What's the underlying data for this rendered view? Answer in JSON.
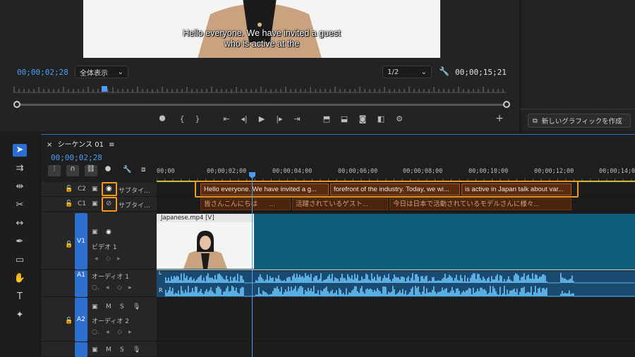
{
  "program_monitor": {
    "caption_line1": "Hello everyone. We have invited a guest",
    "caption_line2": "who is active at the",
    "current_timecode": "00;00;02;28",
    "zoom_label": "全体表示",
    "resolution_label": "1/2",
    "duration_timecode": "00;00;15;21"
  },
  "right_panel": {
    "new_graphic_label": "新しいグラフィックを作成"
  },
  "timeline": {
    "tab_label": "シーケンス 01",
    "timecode": "00;00;02;28",
    "ruler": [
      "00;00",
      "00;00;02;00",
      "00;00;04;00",
      "00;00;06;00",
      "00;00;08;00",
      "00;00;10;00",
      "00;00;12;00",
      "00;00;14;00"
    ],
    "tracks": {
      "c2": {
        "badge": "C2",
        "name": "サブタイ..."
      },
      "c1": {
        "badge": "C1",
        "name": "サブタイ..."
      },
      "v1": {
        "badge": "V1",
        "name": "ビデオ 1"
      },
      "a1": {
        "badge": "A1",
        "name": "オーディオ 1"
      },
      "a2": {
        "badge": "A2",
        "name": "オーディオ 2"
      }
    },
    "c2_clips": [
      "Hello everyone. We have invited a g...",
      "forefront of the industry. Today, we wi...",
      "is active in Japan talk about var..."
    ],
    "c1_clips": [
      "皆さんこんにちは",
      "...",
      "活躍されているゲスト...",
      "今日は日本で活動されているモデルさんに様々..."
    ],
    "video_clip_label": "Japanese.mp4 [V]",
    "audio_l": "L",
    "audio_r": "R",
    "track_m": "M",
    "track_s": "S"
  },
  "colors": {
    "accent": "#2d6fd1",
    "highlight": "#f39a1e",
    "timecode": "#4b9cf5",
    "subtitle_clip": "#5a2c10"
  }
}
